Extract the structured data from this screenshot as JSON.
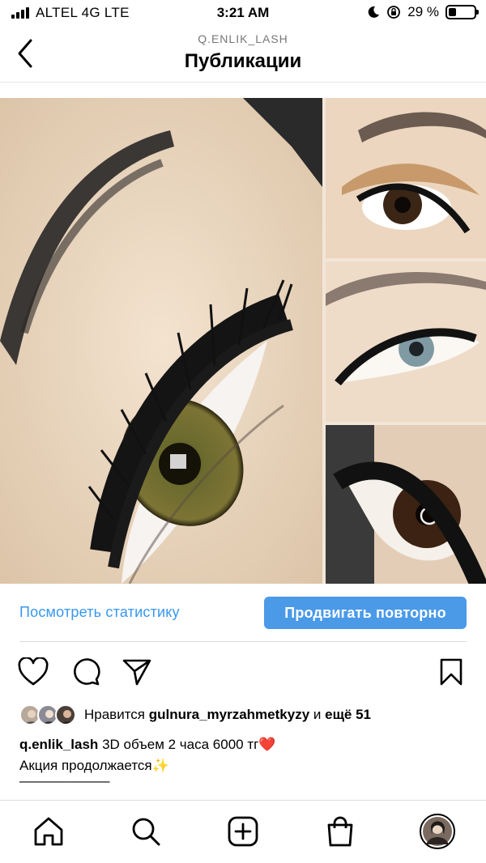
{
  "status_bar": {
    "carrier": "ALTEL 4G  LTE",
    "time": "3:21 AM",
    "battery": "29 %",
    "battery_level": 0.29
  },
  "header": {
    "username": "Q.ENLIK_LASH",
    "title": "Публикации"
  },
  "actions": {
    "stats_link": "Посмотреть статистику",
    "promote_button": "Продвигать повторно"
  },
  "likes": {
    "prefix": "Нравится",
    "user": "gulnura_myrzahmetkyzy",
    "and": "и",
    "others": "ещё 51"
  },
  "caption": {
    "author": "q.enlik_lash",
    "text": "3D объем 2 часа 6000 тг❤️",
    "line2": "Акция продолжается✨",
    "line3": "———–———"
  },
  "icons": {
    "back": "chevron-left-icon",
    "like": "heart-icon",
    "comment": "comment-icon",
    "share": "send-icon",
    "save": "bookmark-icon",
    "home": "home-icon",
    "search": "search-icon",
    "create": "plus-square-icon",
    "shop": "shopping-bag-icon",
    "profile": "profile-avatar"
  },
  "colors": {
    "accent": "#3897f0",
    "button": "#4a9ae8"
  }
}
